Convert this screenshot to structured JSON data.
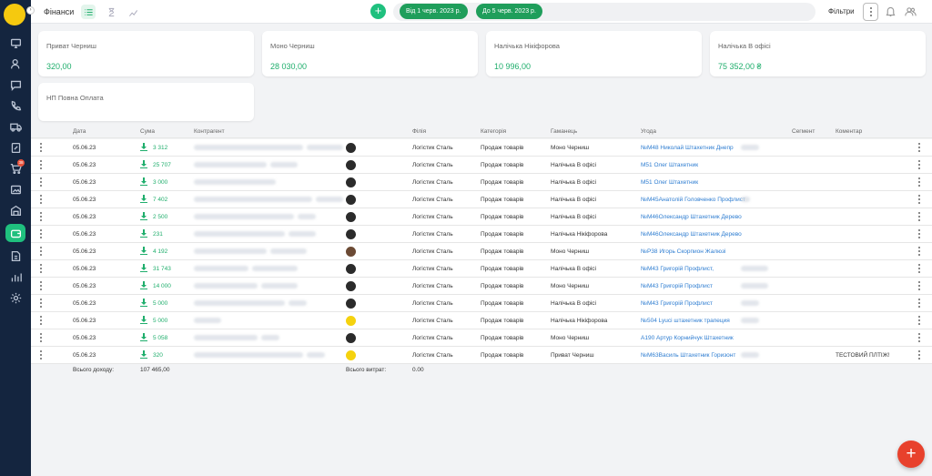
{
  "header": {
    "title": "Фінанси",
    "date_from": "Від 1 черв. 2023 р.",
    "date_to": "До 5 черв. 2023 р.",
    "filters_label": "Фільтри",
    "add_label": "+"
  },
  "sidebar": {
    "notification_count": "38"
  },
  "cards": [
    {
      "title": "Приват Черниш",
      "value": "320,00"
    },
    {
      "title": "Моно Черниш",
      "value": "28 030,00"
    },
    {
      "title": "Налічька Нікіфорова",
      "value": "10 996,00"
    },
    {
      "title": "Налічька В офісі",
      "value": "75 352,00 ₴"
    },
    {
      "title": "НП Повна Оплата",
      "value": ""
    }
  ],
  "table": {
    "columns": [
      "Дата",
      "Сума",
      "Контрагент",
      "Філія",
      "Категорія",
      "Гаманець",
      "Угода",
      "Сегмент",
      "Коментар"
    ],
    "rows": [
      {
        "date": "05.06.23",
        "amount": "3 312",
        "branch": "Логістик Сталь",
        "category": "Продаж товарів",
        "wallet": "Моно Черниш",
        "deal": "№М48 Николай Штахетник Днепр",
        "comment": ""
      },
      {
        "date": "05.06.23",
        "amount": "25 707",
        "branch": "Логістик Сталь",
        "category": "Продаж товарів",
        "wallet": "Налічька В офісі",
        "deal": "М51 Олег Штахетник",
        "comment": ""
      },
      {
        "date": "05.06.23",
        "amount": "3 000",
        "branch": "Логістик Сталь",
        "category": "Продаж товарів",
        "wallet": "Налічька В офісі",
        "deal": "М51 Олег Штахетник",
        "comment": ""
      },
      {
        "date": "05.06.23",
        "amount": "7 402",
        "branch": "Логістик Сталь",
        "category": "Продаж товарів",
        "wallet": "Налічька В офісі",
        "deal": "№М45Анатолій Головченко Профлист",
        "comment": ""
      },
      {
        "date": "05.06.23",
        "amount": "2 500",
        "branch": "Логістик Сталь",
        "category": "Продаж товарів",
        "wallet": "Налічька В офісі",
        "deal": "№М46Олександр Штахетник Дерево",
        "comment": ""
      },
      {
        "date": "05.06.23",
        "amount": "231",
        "branch": "Логістик Сталь",
        "category": "Продаж товарів",
        "wallet": "Налічька Нікіфорова",
        "deal": "№М46Олександр Штахетник Дерево",
        "comment": ""
      },
      {
        "date": "05.06.23",
        "amount": "4 192",
        "branch": "Логістик Сталь",
        "category": "Продаж товарів",
        "wallet": "Моно Черниш",
        "deal": "№Р38 Игорь Скорпион Жалюзі",
        "comment": ""
      },
      {
        "date": "05.06.23",
        "amount": "31 743",
        "branch": "Логістик Сталь",
        "category": "Продаж товарів",
        "wallet": "Налічька В офісі",
        "deal": "№М43 Григорій Профлист,",
        "comment": ""
      },
      {
        "date": "05.06.23",
        "amount": "14 000",
        "branch": "Логістик Сталь",
        "category": "Продаж товарів",
        "wallet": "Моно Черниш",
        "deal": "№М43 Григорій Профлист",
        "comment": ""
      },
      {
        "date": "05.06.23",
        "amount": "5 000",
        "branch": "Логістик Сталь",
        "category": "Продаж товарів",
        "wallet": "Налічька В офісі",
        "deal": "№М43 Григорій Профлист",
        "comment": ""
      },
      {
        "date": "05.06.23",
        "amount": "5 000",
        "branch": "Логістик Сталь",
        "category": "Продаж товарів",
        "wallet": "Налічька Нікіфорова",
        "deal": "№504 Lyuci штахетник трапеция",
        "comment": ""
      },
      {
        "date": "05.06.23",
        "amount": "5 058",
        "branch": "Логістик Сталь",
        "category": "Продаж товарів",
        "wallet": "Моно Черниш",
        "deal": "А190 Артур Корнийчук Штахетник",
        "comment": ""
      },
      {
        "date": "05.06.23",
        "amount": "320",
        "branch": "Логістик Сталь",
        "category": "Продаж товарів",
        "wallet": "Приват Черниш",
        "deal": "№М63Василь Штахетник Горизонт",
        "comment": "ТЕСТОВИЙ ПЛТІЖ!"
      }
    ],
    "footer": {
      "income_label": "Всього доходу:",
      "income_value": "107 465,00",
      "expense_label": "Всього витрат:",
      "expense_value": "0.00"
    }
  },
  "fab_label": "+"
}
